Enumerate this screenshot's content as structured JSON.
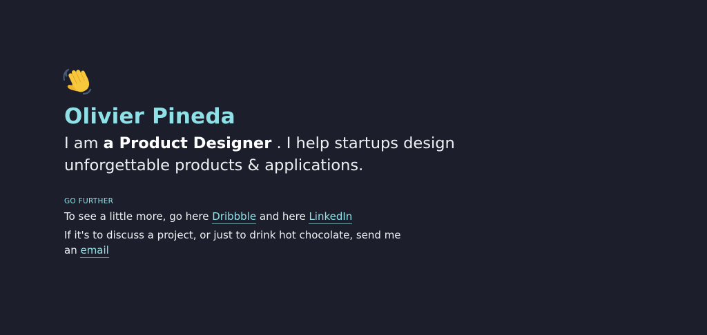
{
  "hero": {
    "wave_emoji": "waving-hand-icon",
    "name": "Olivier Pineda",
    "intro_prefix": "I am ",
    "intro_role": "a Product Designer",
    "intro_suffix": " . I help startups design unforgettable products & applications."
  },
  "further": {
    "label": "GO FURTHER",
    "line1_prefix": "To see a little more, go here ",
    "dribbble_label": "Dribbble",
    "line1_middle": " and here ",
    "linkedin_label": "LinkedIn",
    "line2_prefix": "If it's to discuss a project, or just to drink hot chocolate, send me an ",
    "email_label": "email"
  },
  "colors": {
    "background": "#1c1f2b",
    "accent": "#8fe1e7",
    "text": "#eef0f4"
  }
}
